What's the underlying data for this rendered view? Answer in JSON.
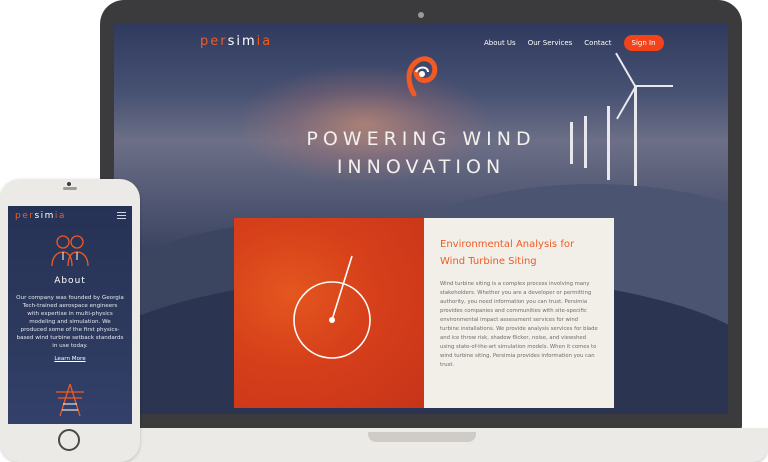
{
  "desktop": {
    "brand": {
      "left": "per",
      "mid": "sim",
      "right": "ia"
    },
    "nav": [
      {
        "label": "About Us"
      },
      {
        "label": "Our Services"
      },
      {
        "label": "Contact"
      }
    ],
    "signin_label": "Sign In",
    "hero": {
      "line1": "POWERING WIND",
      "line2": "INNOVATION"
    },
    "feature": {
      "title": "Environmental Analysis for Wind Turbine Siting",
      "body": "Wind turbine siting is a complex process involving many stakeholders. Whether you are a developer or permitting authority, you need information you can trust. Persimia provides companies and communities with site-specific environmental impact assessment services for wind turbine installations. We provide analysis services for blade and ice throw risk, shadow flicker, noise, and viewshed using state-of-the-art simulation models. When it comes to wind turbine siting, Persimia provides information you can trust."
    }
  },
  "mobile": {
    "brand": {
      "left": "per",
      "mid": "sim",
      "right": "ia"
    },
    "heading": "About",
    "body": "Our company was founded by Georgia Tech-trained aerospace engineers with expertise in multi-physics modeling and simulation. We produced some of the first physics-based wind turbine setback standards in use today.",
    "link": "Learn More"
  },
  "icons": {
    "logo": "persimia-logo-mark-icon",
    "menu": "hamburger-menu-icon",
    "team": "engineers-icon",
    "tower": "transmission-tower-icon",
    "radar": "radar-target-icon"
  },
  "colors": {
    "accent": "#f15a22",
    "panel": "#f2efe9",
    "navy": "#263255"
  }
}
